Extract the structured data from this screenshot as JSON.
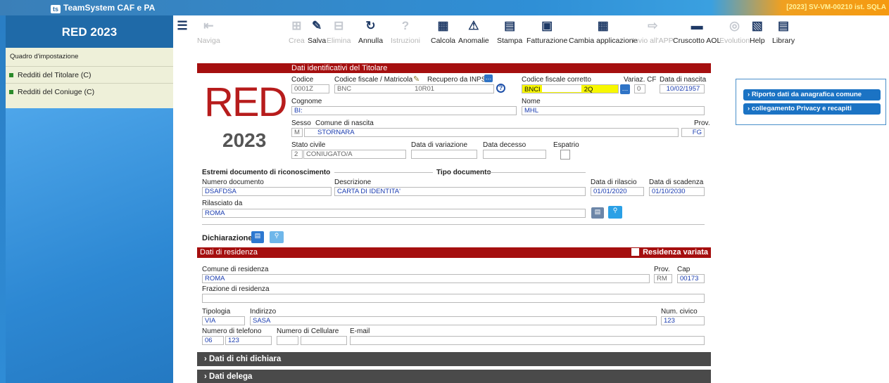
{
  "app": {
    "brand": "TeamSystem CAF e PA",
    "tag": "[2023] SV-VM-00210 ist. SQLA"
  },
  "toolbar": [
    {
      "label": "",
      "icon": "menu-icon",
      "enabled": true
    },
    {
      "label": "Naviga",
      "icon": "navigate-icon",
      "enabled": false
    },
    {
      "label": "Crea",
      "icon": "create-icon",
      "enabled": false
    },
    {
      "label": "Salva",
      "icon": "save-icon",
      "enabled": true
    },
    {
      "label": "Elimina",
      "icon": "delete-icon",
      "enabled": false
    },
    {
      "label": "Annulla",
      "icon": "undo-icon",
      "enabled": true
    },
    {
      "label": "Istruzioni",
      "icon": "help-icon",
      "enabled": false
    },
    {
      "label": "Calcola",
      "icon": "calculator-icon",
      "enabled": true
    },
    {
      "label": "Anomalie",
      "icon": "warning-icon",
      "enabled": true
    },
    {
      "label": "Stampa",
      "icon": "pdf-icon",
      "enabled": true
    },
    {
      "label": "Fatturazione",
      "icon": "invoice-icon",
      "enabled": true
    },
    {
      "label": "Cambia applicazione",
      "icon": "switch-app-icon",
      "enabled": true
    },
    {
      "label": "Invio all'APP",
      "icon": "send-app-icon",
      "enabled": false
    },
    {
      "label": "Cruscotto AOL",
      "icon": "dashboard-icon",
      "enabled": true
    },
    {
      "label": "Evolution",
      "icon": "evolution-icon",
      "enabled": false
    },
    {
      "label": "Help",
      "icon": "help-book-icon",
      "enabled": true
    },
    {
      "label": "Library",
      "icon": "library-icon",
      "enabled": true
    }
  ],
  "sidebar": {
    "title": "RED 2023",
    "section": "Quadro d'impostazione",
    "items": [
      {
        "label": "Redditi del Titolare (C)"
      },
      {
        "label": "Redditi del Coniuge (C)"
      }
    ]
  },
  "header": {
    "big": "RED",
    "year": "2023"
  },
  "titolare": {
    "bar": "Dati identificativi del Titolare",
    "codice_label": "Codice",
    "codice": "0001Z",
    "cf_label": "Codice fiscale / Matricola",
    "cf": "BNC",
    "cf_end": "10R01",
    "recupero_label": "Recupero da INPS",
    "cf_corretto_label": "Codice fiscale corretto",
    "cf_corretto": "BNCI",
    "cf_corretto_end": "2Q",
    "variaz_label": "Variaz. CF",
    "variaz": "0",
    "nascita_label": "Data di nascita",
    "nascita": "10/02/1957",
    "cognome_label": "Cognome",
    "cognome": "BI:",
    "nome_label": "Nome",
    "nome": "MHL",
    "sesso_label": "Sesso",
    "sesso": "M",
    "comune_label": "Comune di nascita",
    "comune": "STORNARA",
    "prov_label": "Prov.",
    "prov": "FG",
    "stato_label": "Stato civile",
    "stato_cod": "2",
    "stato": "CONIUGATO/A",
    "variazione_label": "Data di variazione",
    "decesso_label": "Data decesso",
    "espatrio_label": "Espatrio"
  },
  "documento": {
    "title": "Estremi documento di riconoscimento",
    "tipo_title": "Tipo documento",
    "numero_label": "Numero documento",
    "numero": "DSAFDSA",
    "descr_label": "Descrizione",
    "descr": "CARTA DI IDENTITA'",
    "rilascio_label": "Data di rilascio",
    "rilascio": "01/01/2020",
    "scadenza_label": "Data di scadenza",
    "scadenza": "01/10/2030",
    "rilasciato_label": "Rilasciato da",
    "rilasciato": "ROMA"
  },
  "dichiarazione": {
    "label": "Dichiarazione"
  },
  "residenza": {
    "bar": "Dati di residenza",
    "variata": "Residenza variata",
    "comune_label": "Comune di residenza",
    "comune": "ROMA",
    "prov_label": "Prov.",
    "prov": "RM",
    "cap_label": "Cap",
    "cap": "00173",
    "frazione_label": "Frazione di residenza",
    "tipologia_label": "Tipologia",
    "tipologia": "VIA",
    "indirizzo_label": "Indirizzo",
    "indirizzo": "SASA",
    "civico_label": "Num. civico",
    "civico": "123",
    "tel_label": "Numero di telefono",
    "tel_pref": "06",
    "tel": "123",
    "cell_label": "Numero di Cellulare",
    "email_label": "E-mail"
  },
  "sections": [
    {
      "label": "Dati di chi dichiara"
    },
    {
      "label": "Dati delega"
    }
  ],
  "right_panel": [
    {
      "label": "Riporto dati da anagrafica comune"
    },
    {
      "label": "collegamento Privacy e recapiti"
    }
  ]
}
